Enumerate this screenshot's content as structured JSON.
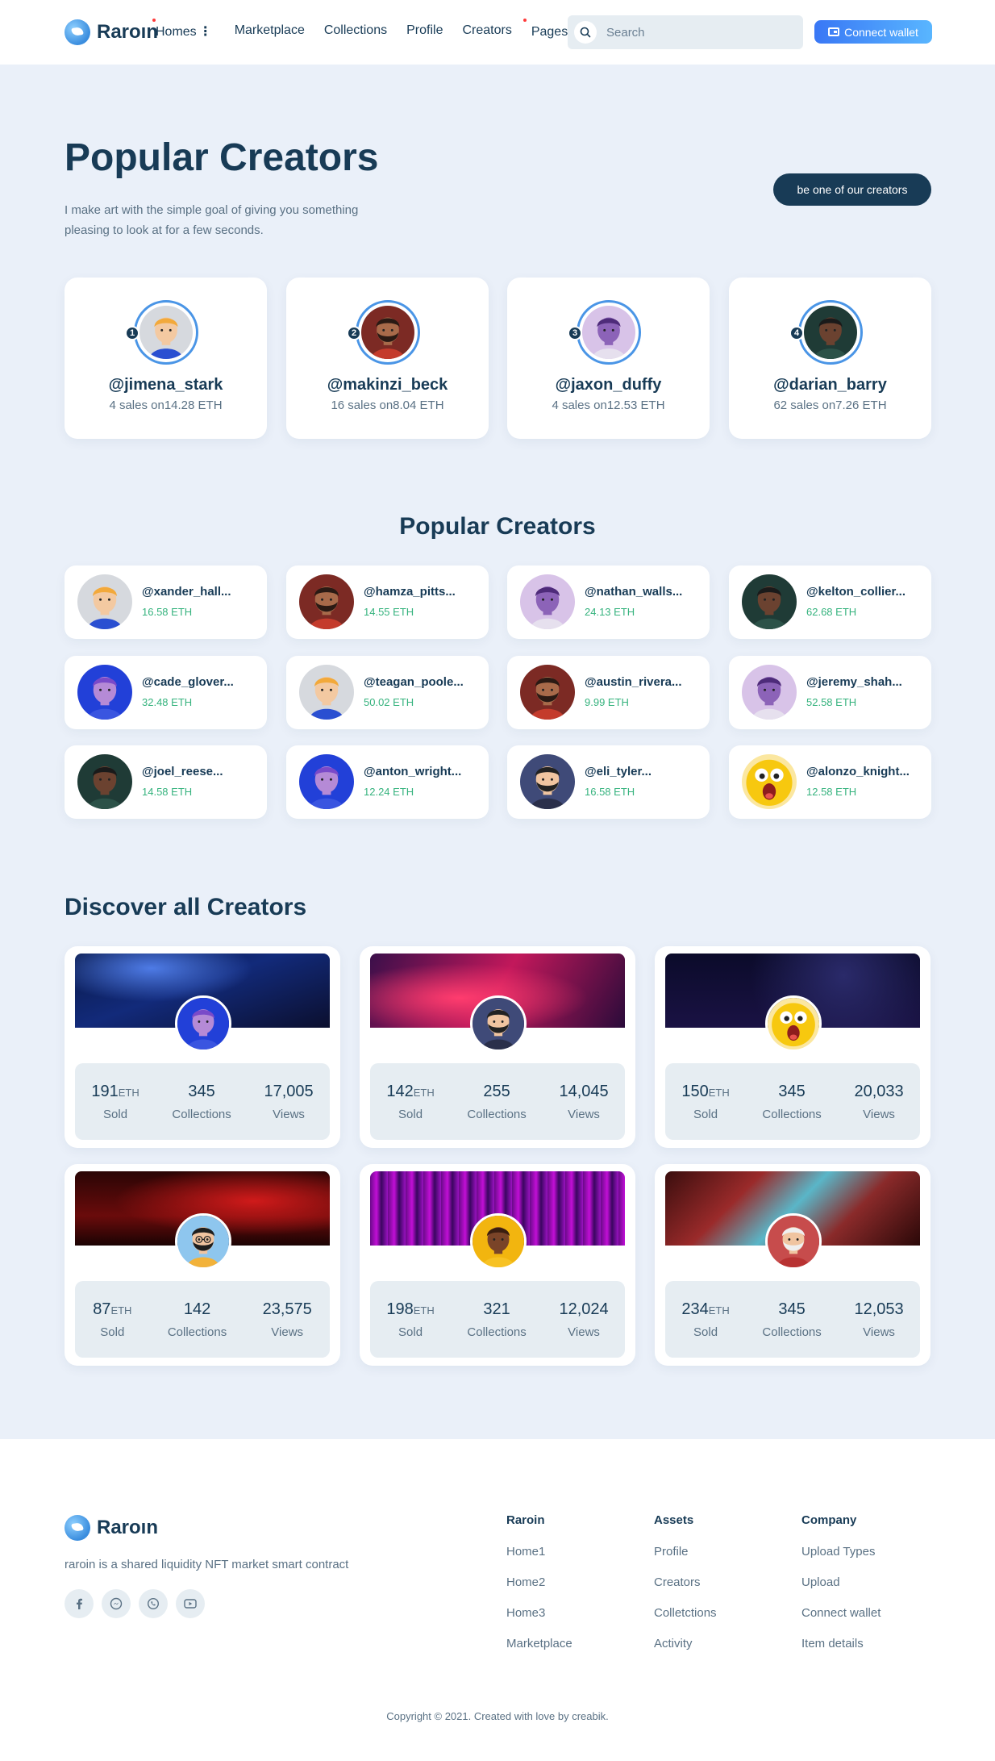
{
  "brand": {
    "name": "Raroın"
  },
  "nav": {
    "items": [
      {
        "label": "Homes",
        "dot": true,
        "kebab": true
      },
      {
        "label": "Marketplace",
        "dot": false,
        "kebab": false
      },
      {
        "label": "Collections",
        "dot": false,
        "kebab": false
      },
      {
        "label": "Profile",
        "dot": false,
        "kebab": false
      },
      {
        "label": "Creators",
        "dot": true,
        "kebab": false
      },
      {
        "label": "Pages",
        "dot": false,
        "kebab": true
      }
    ],
    "search_placeholder": "Search",
    "connect_label": "Connect wallet"
  },
  "hero": {
    "title": "Popular Creators",
    "description": "I make art with the simple goal of giving you something pleasing to look at for a few seconds.",
    "cta_label": "be one of our creators"
  },
  "top_creators": [
    {
      "rank": "1",
      "name": "@jimena_stark",
      "sales": "4 sales on14.28 ETH",
      "avatar": "blond-boy"
    },
    {
      "rank": "2",
      "name": "@makinzi_beck",
      "sales": "16 sales on8.04 ETH",
      "avatar": "bearded-man-red"
    },
    {
      "rank": "3",
      "name": "@jaxon_duffy",
      "sales": "4 sales on12.53 ETH",
      "avatar": "purple-woman"
    },
    {
      "rank": "4",
      "name": "@darian_barry",
      "sales": "62 sales on7.26 ETH",
      "avatar": "dark-man"
    }
  ],
  "popular_section_title": "Popular Creators",
  "popular_creators": [
    {
      "name": "@xander_hall...",
      "eth": "16.58 ETH",
      "avatar": "blond-boy"
    },
    {
      "name": "@hamza_pitts...",
      "eth": "14.55 ETH",
      "avatar": "bearded-man-red"
    },
    {
      "name": "@nathan_walls...",
      "eth": "24.13 ETH",
      "avatar": "purple-woman"
    },
    {
      "name": "@kelton_collier...",
      "eth": "62.68 ETH",
      "avatar": "dark-man"
    },
    {
      "name": "@cade_glover...",
      "eth": "32.48 ETH",
      "avatar": "blue-woman"
    },
    {
      "name": "@teagan_poole...",
      "eth": "50.02 ETH",
      "avatar": "blond-boy"
    },
    {
      "name": "@austin_rivera...",
      "eth": "9.99 ETH",
      "avatar": "bearded-man-red"
    },
    {
      "name": "@jeremy_shah...",
      "eth": "52.58 ETH",
      "avatar": "purple-woman"
    },
    {
      "name": "@joel_reese...",
      "eth": "14.58 ETH",
      "avatar": "dark-man"
    },
    {
      "name": "@anton_wright...",
      "eth": "12.24 ETH",
      "avatar": "blue-woman"
    },
    {
      "name": "@eli_tyler...",
      "eth": "16.58 ETH",
      "avatar": "bearded-man-navy"
    },
    {
      "name": "@alonzo_knight...",
      "eth": "12.58 ETH",
      "avatar": "yellow-emoji"
    }
  ],
  "discover_title": "Discover all Creators",
  "discover": [
    {
      "cover": "blue-space",
      "avatar": "blue-woman",
      "sold": "191",
      "unit": "ETH",
      "collections": "345",
      "views": "17,005"
    },
    {
      "cover": "pink-nebula",
      "avatar": "bearded-man-navy",
      "sold": "142",
      "unit": "ETH",
      "collections": "255",
      "views": "14,045"
    },
    {
      "cover": "dark-stars",
      "avatar": "yellow-emoji",
      "sold": "150",
      "unit": "ETH",
      "collections": "345",
      "views": "20,033"
    },
    {
      "cover": "red-space",
      "avatar": "glasses-man",
      "sold": "87",
      "unit": "ETH",
      "collections": "142",
      "views": "23,575"
    },
    {
      "cover": "purple-glitch",
      "avatar": "yellow-woman",
      "sold": "198",
      "unit": "ETH",
      "collections": "321",
      "views": "12,024"
    },
    {
      "cover": "city-glitch",
      "avatar": "old-man",
      "sold": "234",
      "unit": "ETH",
      "collections": "345",
      "views": "12,053"
    }
  ],
  "stat_labels": {
    "sold": "Sold",
    "collections": "Collections",
    "views": "Views"
  },
  "footer": {
    "description": "raroin is a shared liquidity NFT market smart contract",
    "socials": [
      "facebook-icon",
      "messenger-icon",
      "whatsapp-icon",
      "youtube-icon"
    ],
    "columns": [
      {
        "title": "Raroin",
        "links": [
          "Home1",
          "Home2",
          "Home3",
          "Marketplace"
        ]
      },
      {
        "title": "Assets",
        "links": [
          "Profile",
          "Creators",
          "Colletctions",
          "Activity"
        ]
      },
      {
        "title": "Company",
        "links": [
          "Upload Types",
          "Upload",
          "Connect wallet",
          "Item details"
        ]
      }
    ],
    "copyright": "Copyright © 2021. Created with love by creabik."
  },
  "colors": {
    "navy": "#183b56",
    "accent": "#3977f5",
    "eth_green": "#36b37e",
    "page_bg": "#eaf0f9"
  }
}
